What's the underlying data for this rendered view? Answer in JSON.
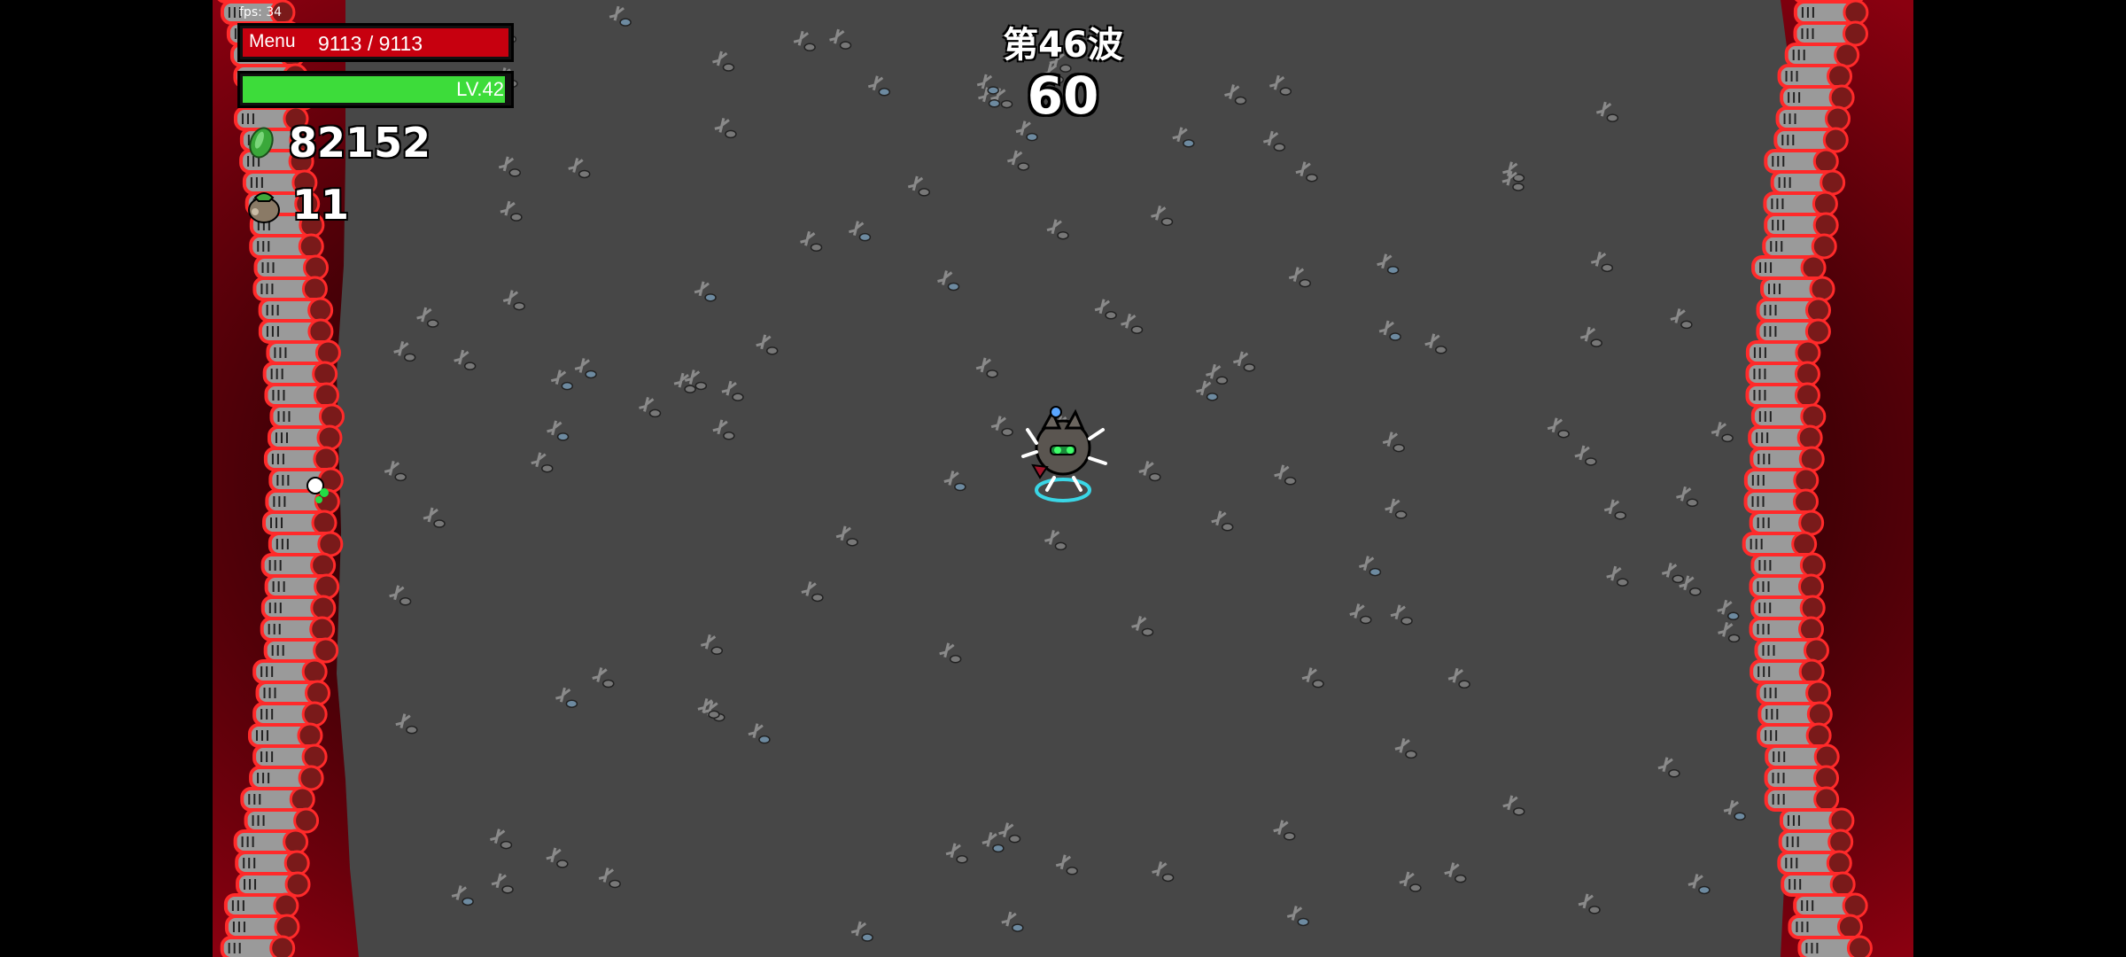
{
  "fps": "fps: 34",
  "hud": {
    "menu_label": "Menu",
    "hp_text": "9113 / 9113",
    "hp_fraction": 1.0,
    "level_text": "LV.42",
    "xp_fraction": 0.985,
    "materials": "82152",
    "bag_count": "11"
  },
  "wave": {
    "title": "第46波",
    "timer": "60"
  },
  "colors": {
    "arena_floor": "#474747",
    "border_blood": "#6a0008",
    "hp_red": "#c7000f",
    "xp_green": "#3ddc3a",
    "enemy_outline": "#ff2a2a",
    "player_ring": "#3ad6e6"
  },
  "icons": {
    "materials": "green-material-icon",
    "bag": "money-bag-icon",
    "enemy": "wrench-enemy-icon",
    "player": "potato-player-icon"
  }
}
